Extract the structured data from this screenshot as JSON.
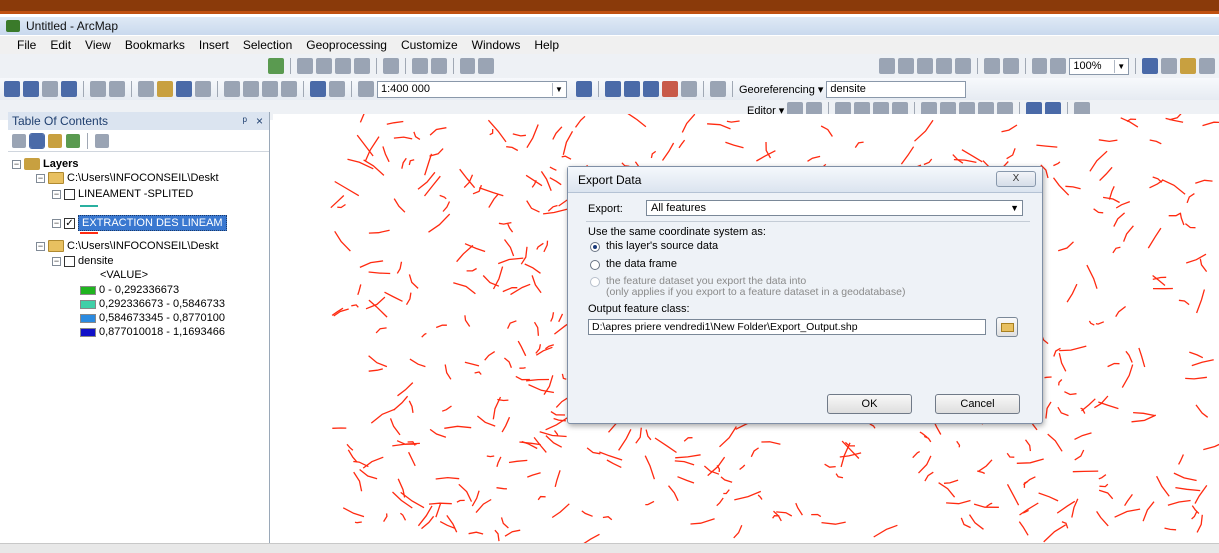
{
  "window": {
    "title": "Untitled - ArcMap"
  },
  "menu": [
    "File",
    "Edit",
    "View",
    "Bookmarks",
    "Insert",
    "Selection",
    "Geoprocessing",
    "Customize",
    "Windows",
    "Help"
  ],
  "toolbar": {
    "scale": "1:400 000",
    "georef_label": "Georeferencing ▾",
    "layer_combo": "densite",
    "editor_label": "Editor ▾",
    "zoom_field": "100%"
  },
  "toc": {
    "title": "Table Of Contents",
    "pin": "ᵖ",
    "close": "×",
    "layers_label": "Layers",
    "group1_path": "C:\\Users\\INFOCONSEIL\\Deskt",
    "layer1": "LINEAMENT -SPLITED",
    "layer2": "EXTRACTION DES LINEAM",
    "group2_path": "C:\\Users\\INFOCONSEIL\\Deskt",
    "layer3": "densite",
    "value_label": "<VALUE>",
    "legend": [
      {
        "label": "0 - 0,292336673",
        "color": "#1fb41f"
      },
      {
        "label": "0,292336673 - 0,5846733",
        "color": "#40d0a8"
      },
      {
        "label": "0,584673345 - 0,8770100",
        "color": "#2a8ae0"
      },
      {
        "label": "0,877010018 - 1,1693466",
        "color": "#1010c8"
      }
    ]
  },
  "dialog": {
    "title": "Export Data",
    "close": "X",
    "export_label": "Export:",
    "export_value": "All features",
    "coord_label": "Use the same coordinate system as:",
    "opt1": "this layer's source data",
    "opt2": "the data frame",
    "opt3": "the feature dataset you export the data into",
    "opt3_note": "(only applies if you export to a feature dataset in a geodatabase)",
    "output_label": "Output feature class:",
    "output_value": "D:\\apres priere vendredi1\\New Folder\\Export_Output.shp",
    "ok": "OK",
    "cancel": "Cancel"
  },
  "colors": {
    "lineament": "#ff2a10",
    "selected": "#3a78d0"
  }
}
